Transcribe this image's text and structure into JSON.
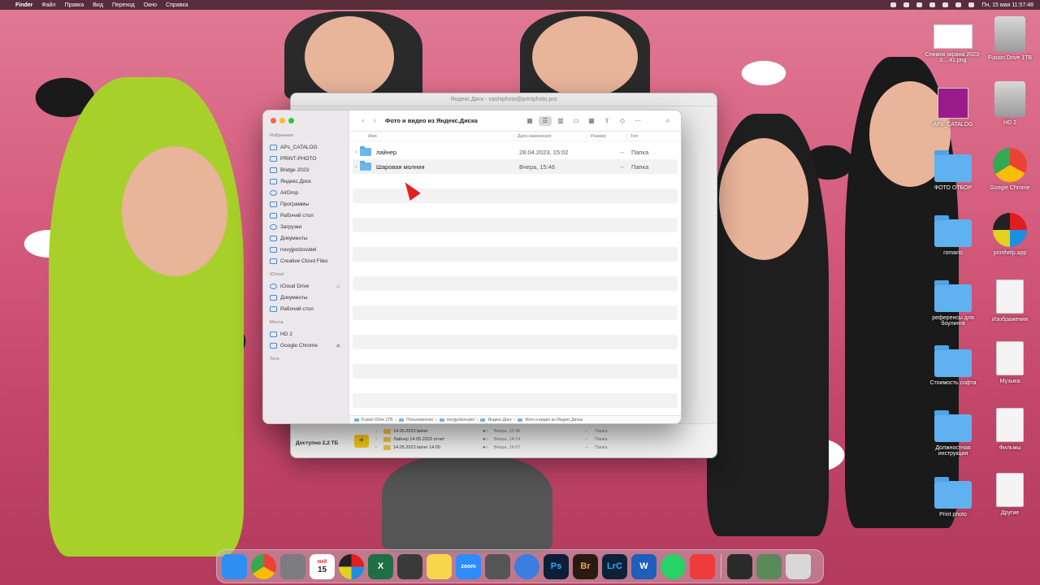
{
  "menubar": {
    "app": "Finder",
    "items": [
      "Файл",
      "Правка",
      "Вид",
      "Переход",
      "Окно",
      "Справка"
    ],
    "clock": "Пн, 15 мая 11:57:48"
  },
  "back_window": {
    "title": "Яндекс.Диск - vashiphoto@printphoto.pro",
    "available": "Доступно 2,2 ТБ",
    "rows": [
      {
        "name": "14.05.2023 lainer",
        "date": "Вчера, 12:40",
        "size": "--",
        "kind": "Папка"
      },
      {
        "name": "Лайнер 14.05.2023 отчет",
        "date": "Вчера, 14:14",
        "size": "--",
        "kind": "Папка"
      },
      {
        "name": "14.05.2023 lainer 14.00",
        "date": "Вчера, 16:07",
        "size": "--",
        "kind": "Папка"
      }
    ]
  },
  "finder": {
    "title": "Фото и видео из Яндекс.Диска",
    "sidebar": {
      "favorites_header": "Избранное",
      "favorites": [
        {
          "label": "APs_CATALOG",
          "icon": "folder-icon"
        },
        {
          "label": "PRINT-PHOTO",
          "icon": "folder-icon"
        },
        {
          "label": "Bridge 2023",
          "icon": "folder-icon"
        },
        {
          "label": "Яндекс.Диск",
          "icon": "folder-icon"
        },
        {
          "label": "AirDrop",
          "icon": "airdrop-icon"
        },
        {
          "label": "Программы",
          "icon": "apps-icon"
        },
        {
          "label": "Рабочий стол",
          "icon": "desktop-icon"
        },
        {
          "label": "Загрузки",
          "icon": "downloads-icon"
        },
        {
          "label": "Документы",
          "icon": "documents-icon"
        },
        {
          "label": "novyjpolzovatel",
          "icon": "home-icon"
        },
        {
          "label": "Creative Cloud Files",
          "icon": "creative-cloud-icon"
        }
      ],
      "icloud_header": "iCloud",
      "icloud": [
        {
          "label": "iCloud Drive",
          "icon": "icloud-icon"
        },
        {
          "label": "Документы",
          "icon": "documents-icon"
        },
        {
          "label": "Рабочий стол",
          "icon": "desktop-icon"
        }
      ],
      "places_header": "Места",
      "places": [
        {
          "label": "HD 2",
          "icon": "disk-icon"
        },
        {
          "label": "Google Chrome",
          "icon": "disk-icon"
        }
      ],
      "tags_header": "Теги"
    },
    "columns": {
      "name": "Имя",
      "date": "Дата изменения",
      "size": "Размер",
      "kind": "Тип"
    },
    "rows": [
      {
        "name": "лайнер",
        "date": "28.04.2023, 15:02",
        "size": "--",
        "kind": "Папка"
      },
      {
        "name": "Шаровая молния",
        "date": "Вчера, 15:46",
        "size": "--",
        "kind": "Папка"
      }
    ],
    "path": [
      "Fusion Drive 1TB",
      "Пользователи",
      "novyjpolzovatel",
      "Яндекс.Диск",
      "Фото и видео из Яндекс.Диска"
    ]
  },
  "desktop_icons": [
    {
      "label": "Снимок экрана 2023-0....41.png",
      "icon": "screenshot-icon"
    },
    {
      "label": "Fusion Drive 1TB",
      "icon": "drive-icon"
    },
    {
      "label": "APs_CATALOG",
      "icon": "catalog-app-icon"
    },
    {
      "label": "HD 2",
      "icon": "drive-icon"
    },
    {
      "label": "ФОТО ОТБОР",
      "icon": "folder-icon"
    },
    {
      "label": "Google Chrome",
      "icon": "chrome-icon"
    },
    {
      "label": "romario",
      "icon": "folder-icon"
    },
    {
      "label": "printhelp.app",
      "icon": "printhelp-icon"
    },
    {
      "label": "референсы для боулинга",
      "icon": "folder-icon"
    },
    {
      "label": "Изображения",
      "icon": "file-icon"
    },
    {
      "label": "Стоимость софта",
      "icon": "folder-icon"
    },
    {
      "label": "Музыка",
      "icon": "music-icon"
    },
    {
      "label": "Должностная инструкция",
      "icon": "folder-icon"
    },
    {
      "label": "Фильмы",
      "icon": "file-icon"
    },
    {
      "label": "Print photo",
      "icon": "folder-icon"
    },
    {
      "label": "Другие",
      "icon": "zip-icon"
    }
  ],
  "dock": [
    {
      "name": "finder-icon",
      "label": "",
      "color": "#2f8ef4"
    },
    {
      "name": "chrome-icon",
      "label": "",
      "color": "#e94235"
    },
    {
      "name": "system-settings-icon",
      "label": "",
      "color": "#7b7b80"
    },
    {
      "name": "calendar-icon",
      "label": "15",
      "month": "МАЙ",
      "color": "#ffffff"
    },
    {
      "name": "printhelp-icon",
      "label": "",
      "color": "#333333"
    },
    {
      "name": "excel-icon",
      "label": "X",
      "color": "#1d7044"
    },
    {
      "name": "calculator-icon",
      "label": "",
      "color": "#3a3a3a"
    },
    {
      "name": "notes-icon",
      "label": "",
      "color": "#f7d64a"
    },
    {
      "name": "zoom-icon",
      "label": "zoom",
      "color": "#2d8cff"
    },
    {
      "name": "printer-icon",
      "label": "",
      "color": "#555555"
    },
    {
      "name": "drive-app-icon",
      "label": "",
      "color": "#3d7de0"
    },
    {
      "name": "photoshop-icon",
      "label": "Ps",
      "color": "#0c1e38"
    },
    {
      "name": "bridge-icon",
      "label": "Br",
      "color": "#2a1b10"
    },
    {
      "name": "lightroom-classic-icon",
      "label": "LrC",
      "color": "#0f213a"
    },
    {
      "name": "word-icon",
      "label": "W",
      "color": "#1d5fbd"
    },
    {
      "name": "whatsapp-icon",
      "label": "",
      "color": "#25d366"
    },
    {
      "name": "anydesk-icon",
      "label": "",
      "color": "#ef3b3b"
    }
  ],
  "dock_right": [
    {
      "name": "lrc-window-icon",
      "color": "#2a2a2a"
    },
    {
      "name": "minimized-window-icon",
      "color": "#5a8a5a"
    },
    {
      "name": "trash-icon",
      "color": "#d8d8d8"
    }
  ]
}
